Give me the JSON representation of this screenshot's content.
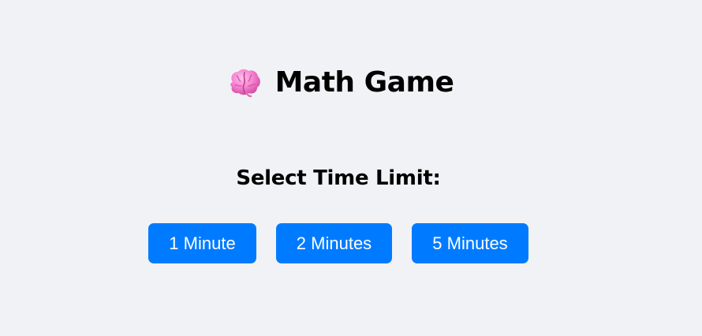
{
  "header": {
    "icon": "brain-icon",
    "title": "Math Game"
  },
  "time_select": {
    "label": "Select Time Limit:",
    "options": [
      {
        "label": "1 Minute"
      },
      {
        "label": "2 Minutes"
      },
      {
        "label": "5 Minutes"
      }
    ]
  },
  "colors": {
    "background": "#f1f2f6",
    "button": "#007bff",
    "button_text": "#ffffff",
    "brain": "#f48fd0"
  }
}
